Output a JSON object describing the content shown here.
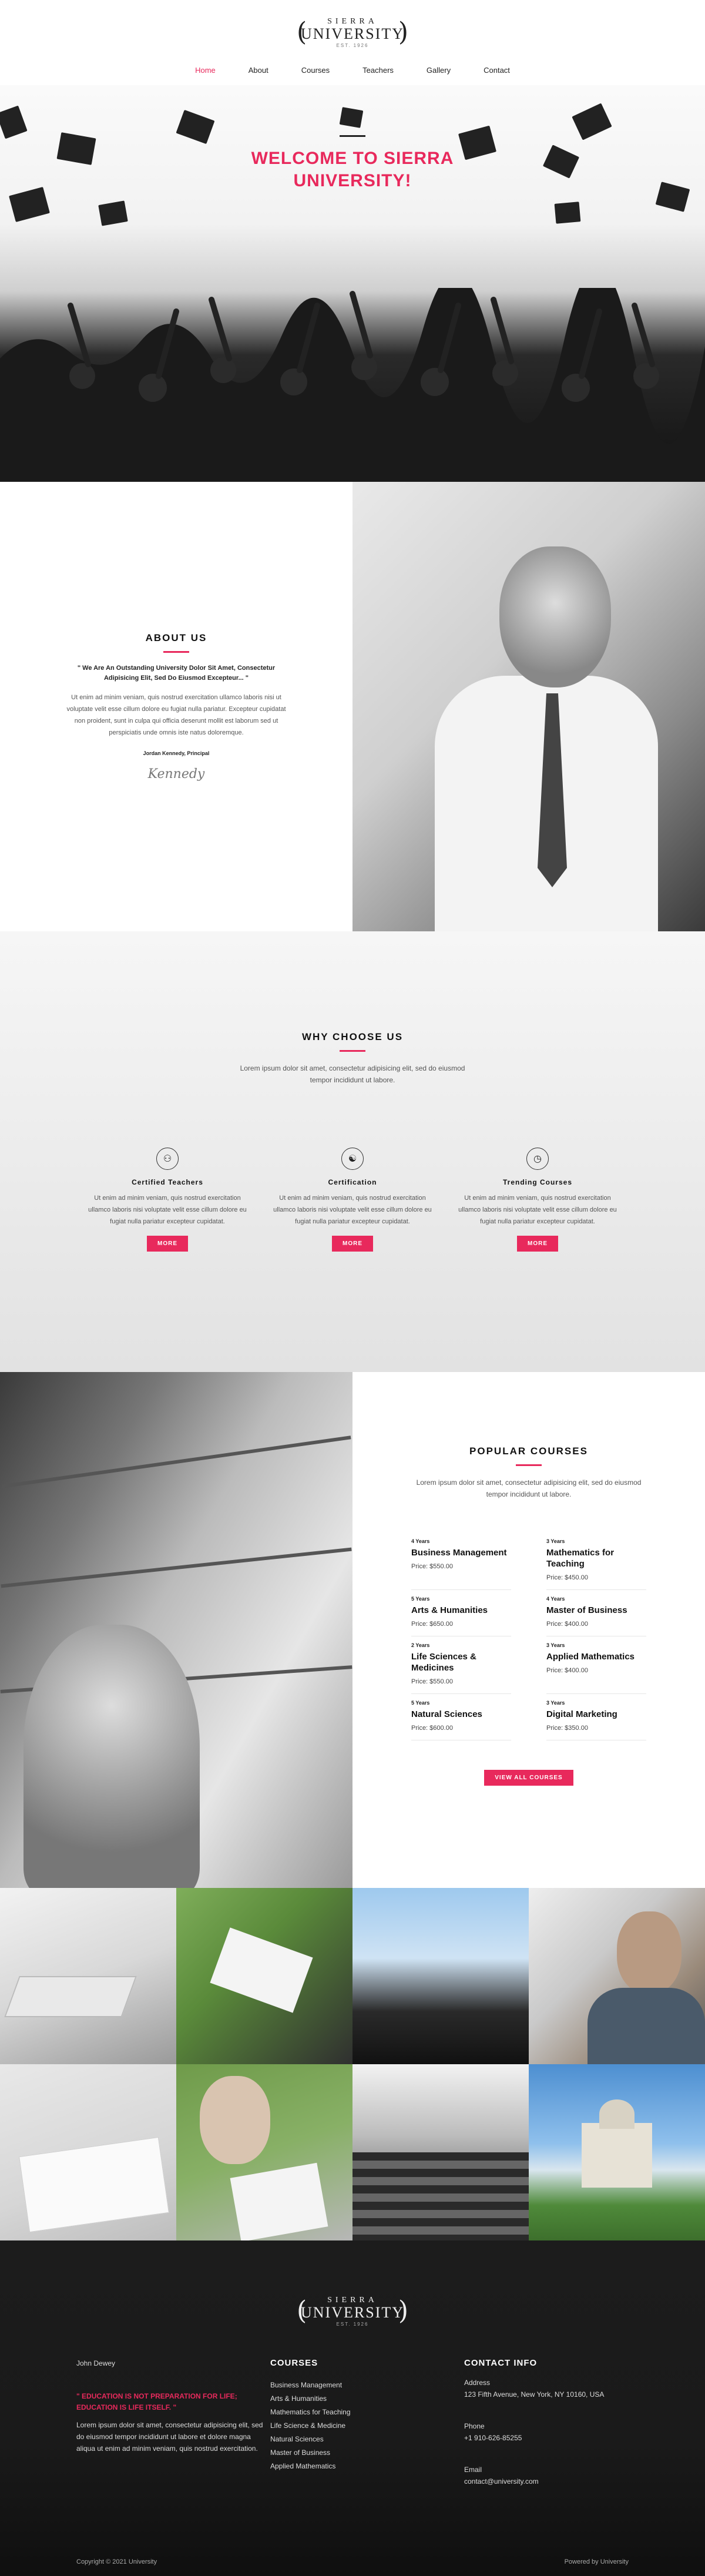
{
  "brand": {
    "top": "SIERRA",
    "main": "UNIVERSITY",
    "est": "EST. 1926"
  },
  "nav": [
    {
      "label": "Home",
      "active": true
    },
    {
      "label": "About"
    },
    {
      "label": "Courses"
    },
    {
      "label": "Teachers"
    },
    {
      "label": "Gallery"
    },
    {
      "label": "Contact"
    }
  ],
  "hero": {
    "title_line1": "WELCOME TO SIERRA",
    "title_line2": "UNIVERSITY!"
  },
  "about": {
    "title": "ABOUT US",
    "quote": "\" We Are An Outstanding University Dolor Sit Amet, Consectetur Adipisicing Elit, Sed Do Eiusmod Excepteur... \"",
    "body": "Ut enim ad minim veniam, quis nostrud exercitation ullamco laboris nisi ut voluptate velit esse cillum dolore eu fugiat nulla pariatur. Excepteur cupidatat non proident, sunt in culpa qui officia deserunt mollit est laborum sed ut perspiciatis unde omnis iste natus doloremque.",
    "signer": "Jordan Kennedy, Principal",
    "signature": "Kennedy"
  },
  "why": {
    "title": "WHY CHOOSE US",
    "intro": "Lorem ipsum dolor sit amet, consectetur adipisicing elit, sed do eiusmod tempor incididunt ut labore.",
    "features": [
      {
        "icon": "teachers-icon",
        "title": "Certified Teachers",
        "text": "Ut enim ad minim veniam, quis nostrud exercitation ullamco laboris nisi voluptate velit esse cillum dolore eu fugiat nulla pariatur excepteur cupidatat.",
        "button": "MORE"
      },
      {
        "icon": "certificate-icon",
        "title": "Certification",
        "text": "Ut enim ad minim veniam, quis nostrud exercitation ullamco laboris nisi voluptate velit esse cillum dolore eu fugiat nulla pariatur excepteur cupidatat.",
        "button": "MORE"
      },
      {
        "icon": "clock-icon",
        "title": "Trending Courses",
        "text": "Ut enim ad minim veniam, quis nostrud exercitation ullamco laboris nisi voluptate velit esse cillum dolore eu fugiat nulla pariatur excepteur cupidatat.",
        "button": "MORE"
      }
    ]
  },
  "courses": {
    "title": "POPULAR COURSES",
    "intro": "Lorem ipsum dolor sit amet, consectetur adipisicing elit, sed do eiusmod tempor incididunt ut labore.",
    "items": [
      {
        "years": "4 Years",
        "name": "Business Management",
        "price": "Price: $550.00"
      },
      {
        "years": "3 Years",
        "name": "Mathematics for Teaching",
        "price": "Price: $450.00"
      },
      {
        "years": "5 Years",
        "name": "Arts & Humanities",
        "price": "Price: $650.00"
      },
      {
        "years": "4 Years",
        "name": "Master of Business",
        "price": "Price: $400.00"
      },
      {
        "years": "2 Years",
        "name": "Life Sciences & Medicines",
        "price": "Price: $550.00"
      },
      {
        "years": "3 Years",
        "name": "Applied Mathematics",
        "price": "Price: $400.00"
      },
      {
        "years": "5 Years",
        "name": "Natural Sciences",
        "price": "Price: $600.00"
      },
      {
        "years": "3 Years",
        "name": "Digital Marketing",
        "price": "Price: $350.00"
      }
    ],
    "button": "VIEW ALL COURSES"
  },
  "footer": {
    "author": "John Dewey",
    "quote": "\" EDUCATION IS NOT PREPARATION FOR LIFE; EDUCATION IS LIFE ITSELF. \"",
    "text": "Lorem ipsum dolor sit amet, consectetur adipisicing elit, sed do eiusmod tempor incididunt ut labore et dolore magna aliqua ut enim ad minim veniam, quis nostrud exercitation.",
    "courses_title": "COURSES",
    "course_links": [
      "Business Management",
      "Arts & Humanities",
      "Mathematics for Teaching",
      "Life Science & Medicine",
      "Natural Sciences",
      "Master of Business",
      "Applied Mathematics"
    ],
    "contact_title": "CONTACT INFO",
    "address_label": "Address",
    "address": "123 Fifth Avenue, New York, NY 10160, USA",
    "phone_label": "Phone",
    "phone": "+1 910-626-85255",
    "email_label": "Email",
    "email": "contact@university.com",
    "copyright": "Copyright © 2021 University",
    "powered": "Powered by University"
  },
  "colors": {
    "accent": "#e8295c",
    "dark": "#1c1c1c"
  }
}
